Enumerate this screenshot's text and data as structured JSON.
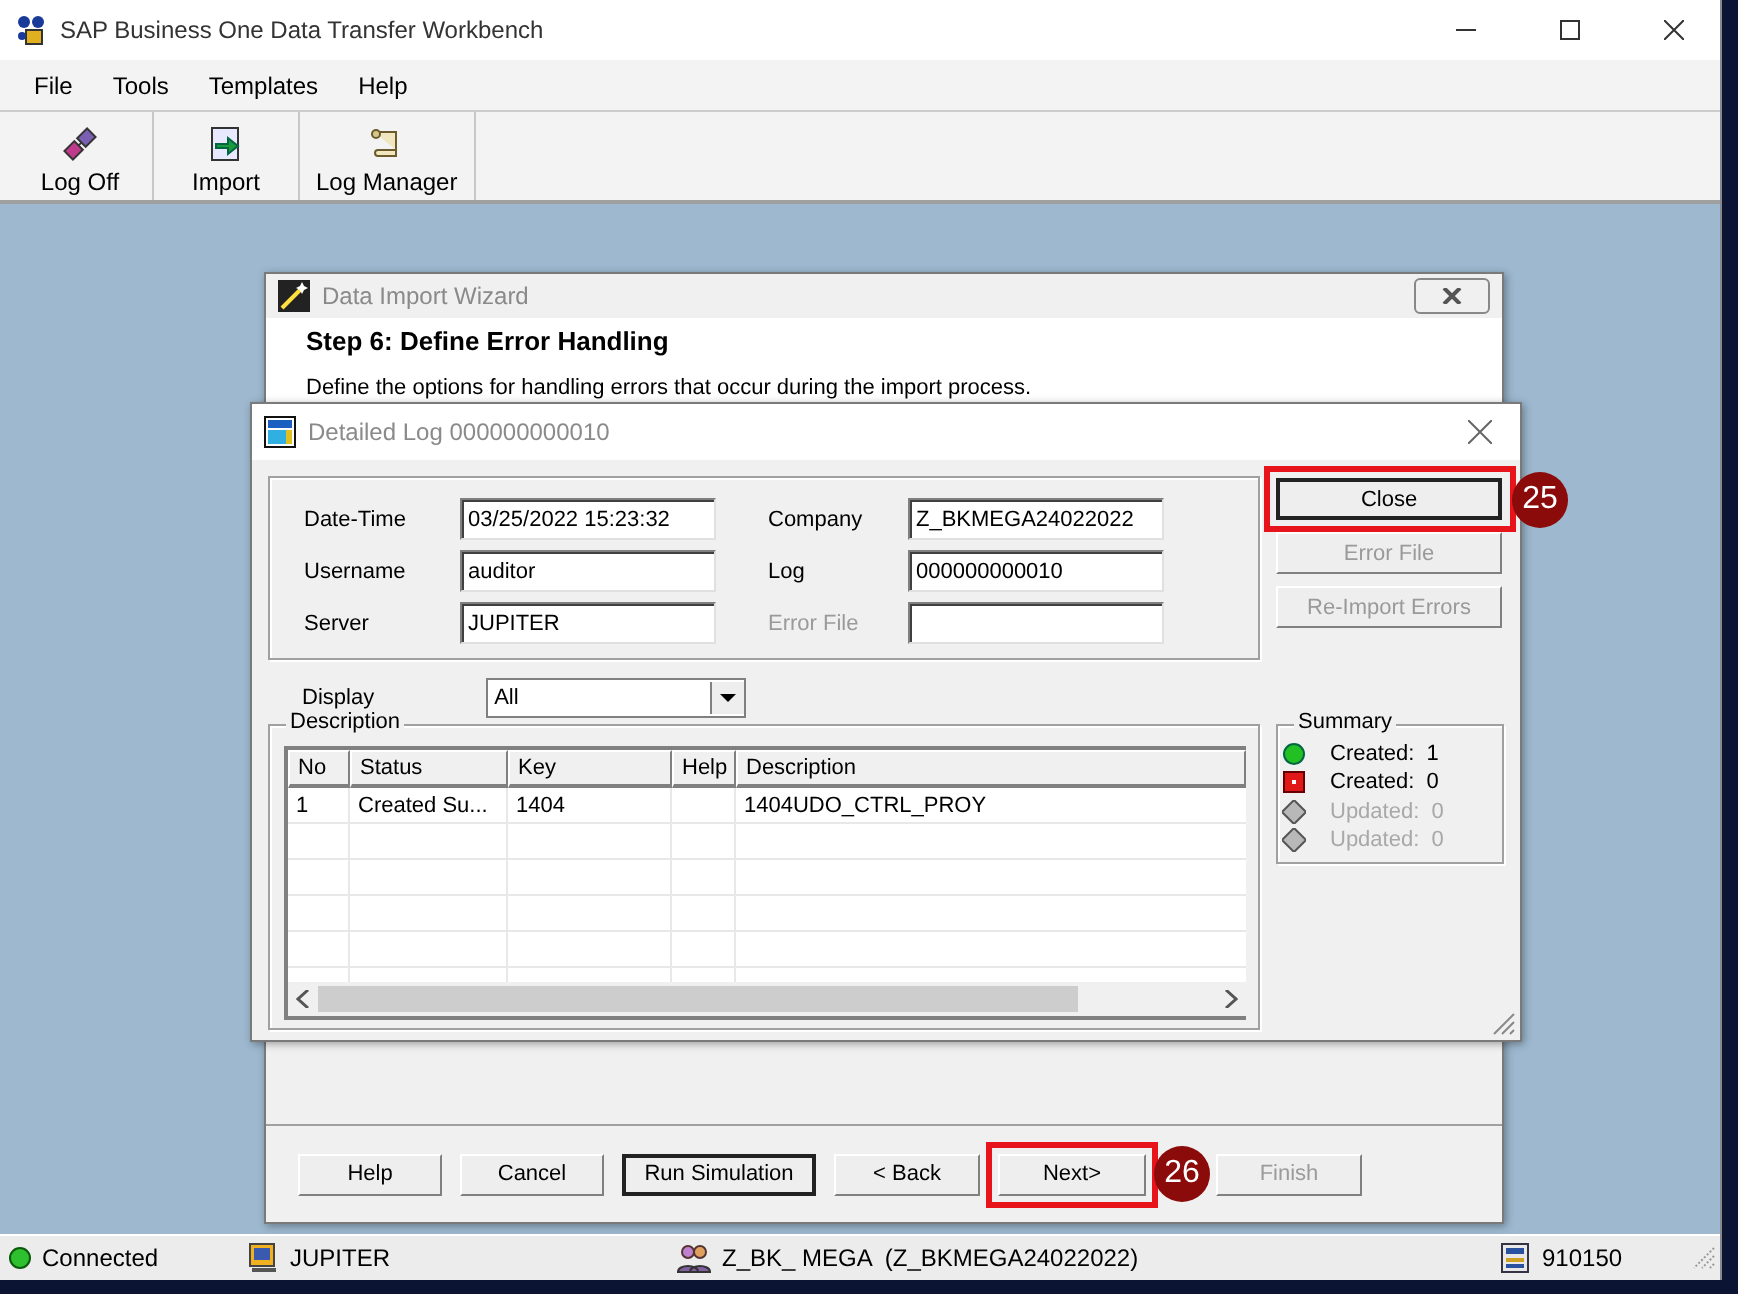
{
  "window": {
    "title": "SAP Business One Data Transfer Workbench"
  },
  "menu": [
    "File",
    "Tools",
    "Templates",
    "Help"
  ],
  "toolbar": [
    {
      "kind": "logoff",
      "label": "Log Off"
    },
    {
      "kind": "import",
      "label": "Import"
    },
    {
      "kind": "log",
      "label": "Log Manager"
    }
  ],
  "wizard": {
    "title": "Data Import Wizard",
    "step": "Step 6: Define Error Handling",
    "description": "Define the options for handling errors that occur during the import process.",
    "buttons": [
      {
        "label": "Help",
        "default": false,
        "disabled": false
      },
      {
        "label": "Cancel",
        "default": false,
        "disabled": false
      },
      {
        "label": "Run Simulation",
        "default": true,
        "disabled": false
      },
      {
        "label": "< Back",
        "default": false,
        "disabled": false
      },
      {
        "label": "Next>",
        "default": false,
        "disabled": false,
        "callout": "26"
      },
      {
        "label": "Finish",
        "default": false,
        "disabled": true
      }
    ]
  },
  "detailed_log": {
    "title": "Detailed Log 000000000010",
    "fields": [
      {
        "label": "Date-Time",
        "value": "03/25/2022 15:23:32",
        "disabled": false
      },
      {
        "label": "Company",
        "value": "Z_BKMEGA24022022",
        "disabled": false
      },
      {
        "label": "Username",
        "value": "auditor",
        "disabled": false
      },
      {
        "label": "Log",
        "value": "000000000010",
        "disabled": false
      },
      {
        "label": "Server",
        "value": "JUPITER",
        "disabled": false
      },
      {
        "label": "Error File",
        "disabled": true
      }
    ],
    "actions": [
      {
        "label": "Close",
        "default": true,
        "disabled": false,
        "callout": "25"
      },
      {
        "label": "Error File",
        "default": false,
        "disabled": true
      },
      {
        "label": "Re-Import Errors",
        "default": false,
        "disabled": true
      }
    ],
    "display": {
      "label": "Display",
      "value": "All"
    },
    "description_group": "Description",
    "table": {
      "columns": [
        "No",
        "Status",
        "Key",
        "Help",
        "Description"
      ],
      "rows": [
        [
          "1",
          "Created Su...",
          "1404",
          "",
          "1404UDO_CTRL_PROY"
        ]
      ]
    },
    "summary": {
      "title": "Summary",
      "items": [
        {
          "kind": "success",
          "label": "Created:",
          "count": "1",
          "disabled": false
        },
        {
          "kind": "error",
          "label": "Created:",
          "count": "0",
          "disabled": false
        },
        {
          "kind": "neutral",
          "label": "Updated:",
          "count": "0",
          "disabled": true
        },
        {
          "kind": "neutral",
          "label": "Updated:",
          "count": "0",
          "disabled": true
        }
      ]
    }
  },
  "status_bar": [
    {
      "kind": "connection",
      "text": "Connected"
    },
    {
      "kind": "server",
      "text": "JUPITER"
    },
    {
      "kind": "company",
      "text": "Z_BK_ MEGA  (Z_BKMEGA24022022)"
    },
    {
      "kind": "version",
      "text": "910150"
    }
  ]
}
